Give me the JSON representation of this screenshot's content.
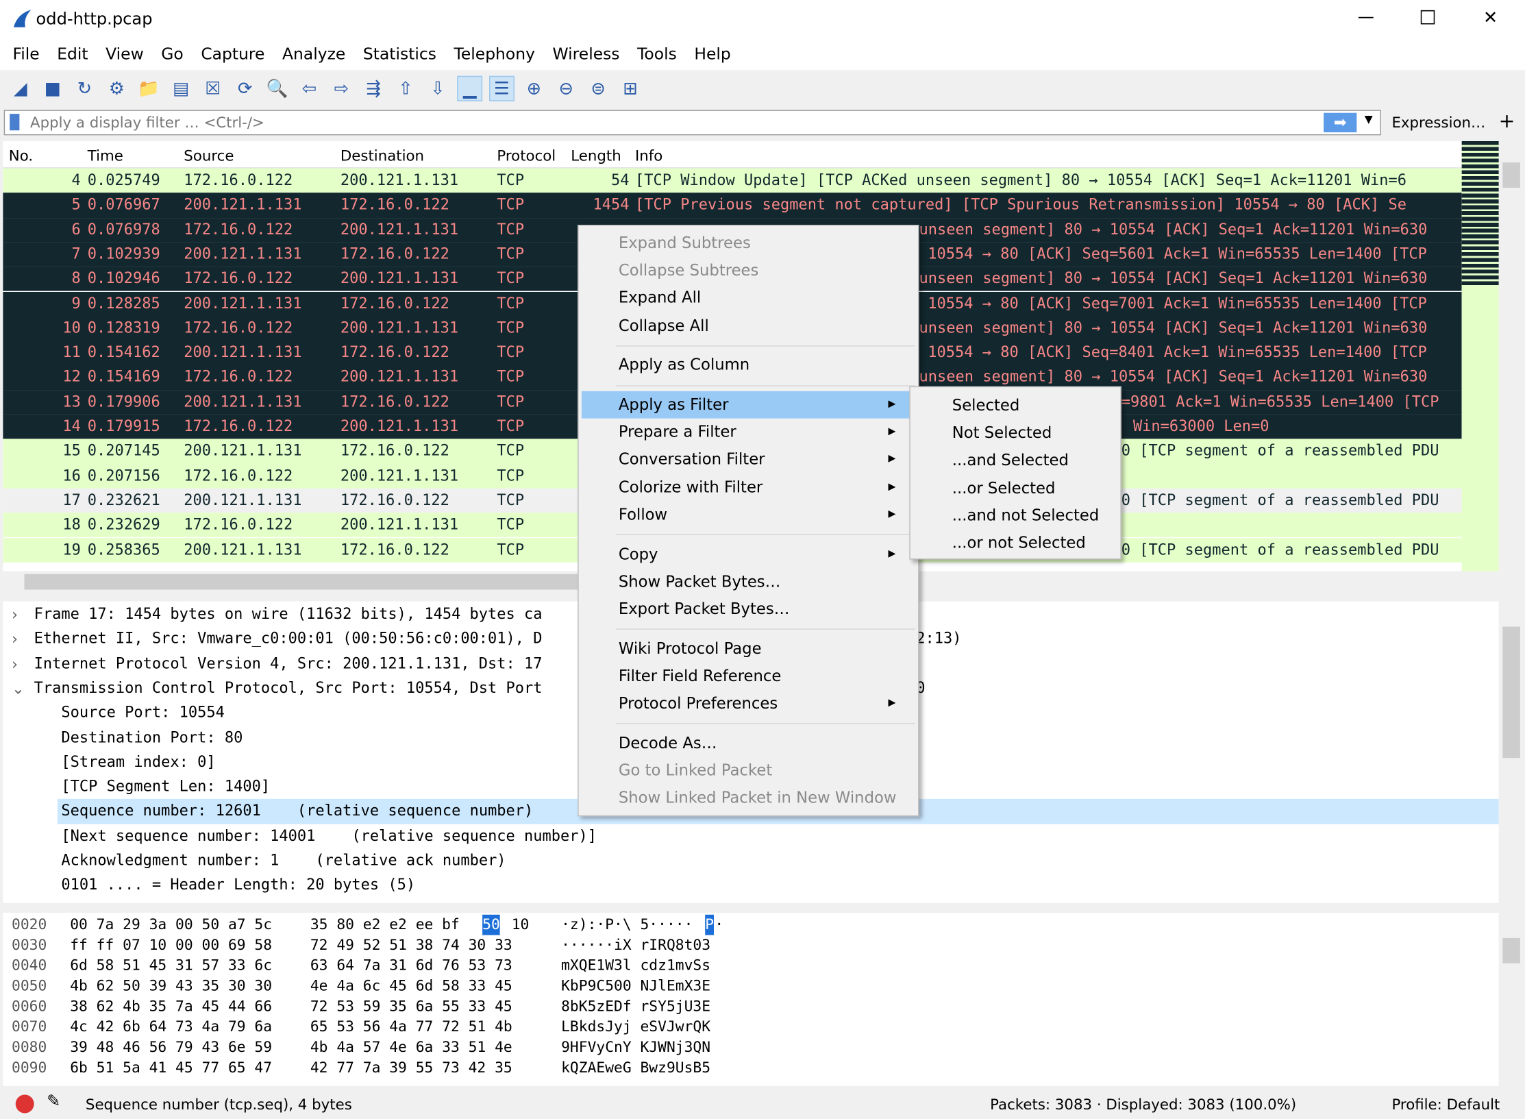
{
  "window": {
    "title": "odd-http.pcap",
    "minimize": "—",
    "maximize": "☐",
    "close": "✕"
  },
  "menu": [
    "File",
    "Edit",
    "View",
    "Go",
    "Capture",
    "Analyze",
    "Statistics",
    "Telephony",
    "Wireless",
    "Tools",
    "Help"
  ],
  "toolbar_icons": [
    "shark-fin-start-icon",
    "stop-icon",
    "restart-icon",
    "options-gear-icon",
    "open-folder-icon",
    "save-file-icon",
    "close-file-icon",
    "reload-icon",
    "find-icon",
    "back-arrow-icon",
    "forward-arrow-icon",
    "go-to-packet-icon",
    "first-packet-icon",
    "last-packet-icon",
    "autoscroll-icon",
    "colorize-icon",
    "zoom-in-icon",
    "zoom-out-icon",
    "normal-size-icon",
    "resize-columns-icon"
  ],
  "filter": {
    "placeholder": "Apply a display filter … <Ctrl-/>",
    "expression": "Expression…",
    "plus": "+"
  },
  "columns": [
    "No.",
    "Time",
    "Source",
    "Destination",
    "Protocol",
    "Length",
    "Info"
  ],
  "packets": [
    {
      "no": "4",
      "time": "0.025749",
      "src": "172.16.0.122",
      "dst": "200.121.1.131",
      "proto": "TCP",
      "len": "54",
      "info": "[TCP Window Update] [TCP ACKed unseen segment] 80 → 10554 [ACK] Seq=1 Ack=11201 Win=6",
      "style": "g"
    },
    {
      "no": "5",
      "time": "0.076967",
      "src": "200.121.1.131",
      "dst": "172.16.0.122",
      "proto": "TCP",
      "len": "1454",
      "info": "[TCP Previous segment not captured] [TCP Spurious Retransmission] 10554 → 80 [ACK] Se",
      "style": "d"
    },
    {
      "no": "6",
      "time": "0.076978",
      "src": "172.16.0.122",
      "dst": "200.121.1.131",
      "proto": "TCP",
      "len": "",
      "info": "unseen segment] 80 → 10554 [ACK] Seq=1 Ack=11201 Win=630",
      "style": "d"
    },
    {
      "no": "7",
      "time": "0.102939",
      "src": "200.121.1.131",
      "dst": "172.16.0.122",
      "proto": "TCP",
      "len": "",
      "info": "10554 → 80 [ACK] Seq=5601 Ack=1 Win=65535 Len=1400 [TCP",
      "style": "d"
    },
    {
      "no": "8",
      "time": "0.102946",
      "src": "172.16.0.122",
      "dst": "200.121.1.131",
      "proto": "TCP",
      "len": "",
      "info": "unseen segment] 80 → 10554 [ACK] Seq=1 Ack=11201 Win=630",
      "style": "d"
    },
    {
      "no": "9",
      "time": "0.128285",
      "src": "200.121.1.131",
      "dst": "172.16.0.122",
      "proto": "TCP",
      "len": "",
      "info": "10554 → 80 [ACK] Seq=7001 Ack=1 Win=65535 Len=1400 [TCP",
      "style": "d"
    },
    {
      "no": "10",
      "time": "0.128319",
      "src": "172.16.0.122",
      "dst": "200.121.1.131",
      "proto": "TCP",
      "len": "",
      "info": "unseen segment] 80 → 10554 [ACK] Seq=1 Ack=11201 Win=630",
      "style": "d"
    },
    {
      "no": "11",
      "time": "0.154162",
      "src": "200.121.1.131",
      "dst": "172.16.0.122",
      "proto": "TCP",
      "len": "",
      "info": "10554 → 80 [ACK] Seq=8401 Ack=1 Win=65535 Len=1400 [TCP",
      "style": "d"
    },
    {
      "no": "12",
      "time": "0.154169",
      "src": "172.16.0.122",
      "dst": "200.121.1.131",
      "proto": "TCP",
      "len": "",
      "info": "unseen segment] 80 → 10554 [ACK] Seq=1 Ack=11201 Win=630",
      "style": "d"
    },
    {
      "no": "13",
      "time": "0.179906",
      "src": "200.121.1.131",
      "dst": "172.16.0.122",
      "proto": "TCP",
      "len": "",
      "info": "=9801 Ack=1 Win=65535 Len=1400 [TCP",
      "style": "d"
    },
    {
      "no": "14",
      "time": "0.179915",
      "src": "172.16.0.122",
      "dst": "200.121.1.131",
      "proto": "TCP",
      "len": "",
      "info": "Win=63000 Len=0",
      "style": "d"
    },
    {
      "no": "15",
      "time": "0.207145",
      "src": "200.121.1.131",
      "dst": "172.16.0.122",
      "proto": "TCP",
      "len": "",
      "info": "0 [TCP segment of a reassembled PDU",
      "style": "g"
    },
    {
      "no": "16",
      "time": "0.207156",
      "src": "172.16.0.122",
      "dst": "200.121.1.131",
      "proto": "TCP",
      "len": "",
      "info": "",
      "style": "g"
    },
    {
      "no": "17",
      "time": "0.232621",
      "src": "200.121.1.131",
      "dst": "172.16.0.122",
      "proto": "TCP",
      "len": "",
      "info": "0 [TCP segment of a reassembled PDU",
      "style": "w"
    },
    {
      "no": "18",
      "time": "0.232629",
      "src": "172.16.0.122",
      "dst": "200.121.1.131",
      "proto": "TCP",
      "len": "",
      "info": "",
      "style": "g"
    },
    {
      "no": "19",
      "time": "0.258365",
      "src": "200.121.1.131",
      "dst": "172.16.0.122",
      "proto": "TCP",
      "len": "",
      "info": "0 [TCP segment of a reassembled PDU",
      "style": "g"
    }
  ],
  "context_menu": [
    {
      "label": "Expand Subtrees",
      "disabled": true
    },
    {
      "label": "Collapse Subtrees",
      "disabled": true
    },
    {
      "label": "Expand All"
    },
    {
      "label": "Collapse All"
    },
    {
      "label": "Apply as Column"
    },
    {
      "label": "Apply as Filter",
      "submenu": true,
      "highlighted": true
    },
    {
      "label": "Prepare a Filter",
      "submenu": true
    },
    {
      "label": "Conversation Filter",
      "submenu": true
    },
    {
      "label": "Colorize with Filter",
      "submenu": true
    },
    {
      "label": "Follow",
      "submenu": true
    },
    {
      "label": "Copy",
      "submenu": true
    },
    {
      "label": "Show Packet Bytes…"
    },
    {
      "label": "Export Packet Bytes…"
    },
    {
      "label": "Wiki Protocol Page"
    },
    {
      "label": "Filter Field Reference"
    },
    {
      "label": "Protocol Preferences",
      "submenu": true
    },
    {
      "label": "Decode As…"
    },
    {
      "label": "Go to Linked Packet",
      "disabled": true
    },
    {
      "label": "Show Linked Packet in New Window",
      "disabled": true
    }
  ],
  "submenu": [
    "Selected",
    "Not Selected",
    "...and Selected",
    "...or Selected",
    "...and not Selected",
    "...or not Selected"
  ],
  "details": [
    {
      "text": "Frame 17: 1454 bytes on wire (11632 bits), 1454 bytes ca",
      "tail": "",
      "expander": "›",
      "indent": 0
    },
    {
      "text": "Ethernet II, Src: Vmware_c0:00:01 (00:50:56:c0:00:01), D",
      "tail": "2:13)",
      "expander": "›",
      "indent": 0
    },
    {
      "text": "Internet Protocol Version 4, Src: 200.121.1.131, Dst: 17",
      "tail": "",
      "expander": "›",
      "indent": 0
    },
    {
      "text": "Transmission Control Protocol, Src Port: 10554, Dst Port",
      "tail": "0",
      "expander": "⌄",
      "indent": 0
    },
    {
      "text": "Source Port: 10554",
      "indent": 1
    },
    {
      "text": "Destination Port: 80",
      "indent": 1
    },
    {
      "text": "[Stream index: 0]",
      "indent": 1
    },
    {
      "text": "[TCP Segment Len: 1400]",
      "indent": 1
    },
    {
      "text": "Sequence number: 12601    (relative sequence number)",
      "indent": 1,
      "selected": true
    },
    {
      "text": "[Next sequence number: 14001    (relative sequence number)]",
      "indent": 1
    },
    {
      "text": "Acknowledgment number: 1    (relative ack number)",
      "indent": 1
    },
    {
      "text": "0101 .... = Header Length: 20 bytes (5)",
      "indent": 1
    }
  ],
  "bytes": [
    {
      "off": "0020",
      "hex1": "00 7a 29 3a 00 50 a7 5c",
      "hex2": "35 80 e2 e2 ee bf",
      "hl": "50",
      "hex3": "10",
      "asc1": "·z):·P·\\ 5·····",
      "aschl": "P",
      "asc2": "·"
    },
    {
      "off": "0030",
      "hex1": "ff ff 07 10 00 00 69 58",
      "hex2": "72 49 52 51 38 74 30 33",
      "asc1": "······iX rIRQ8t03"
    },
    {
      "off": "0040",
      "hex1": "6d 58 51 45 31 57 33 6c",
      "hex2": "63 64 7a 31 6d 76 53 73",
      "asc1": "mXQE1W3l cdz1mvSs"
    },
    {
      "off": "0050",
      "hex1": "4b 62 50 39 43 35 30 30",
      "hex2": "4e 4a 6c 45 6d 58 33 45",
      "asc1": "KbP9C500 NJlEmX3E"
    },
    {
      "off": "0060",
      "hex1": "38 62 4b 35 7a 45 44 66",
      "hex2": "72 53 59 35 6a 55 33 45",
      "asc1": "8bK5zEDf rSY5jU3E"
    },
    {
      "off": "0070",
      "hex1": "4c 42 6b 64 73 4a 79 6a",
      "hex2": "65 53 56 4a 77 72 51 4b",
      "asc1": "LBkdsJyj eSVJwrQK"
    },
    {
      "off": "0080",
      "hex1": "39 48 46 56 79 43 6e 59",
      "hex2": "4b 4a 57 4e 6a 33 51 4e",
      "asc1": "9HFVyCnY KJWNj3QN"
    },
    {
      "off": "0090",
      "hex1": "6b 51 5a 41 45 77 65 47",
      "hex2": "42 77 7a 39 55 73 42 35",
      "asc1": "kQZAEweG Bwz9UsB5"
    }
  ],
  "status": {
    "field": "Sequence number (tcp.seq), 4 bytes",
    "packets": "Packets: 3083 · Displayed: 3083 (100.0%)",
    "profile": "Profile: Default"
  },
  "colors": {
    "green_row": "#e4ffc7",
    "dark_row": "#12272e",
    "dark_text": "#f78787",
    "selection": "#cce8ff",
    "menu_highlight": "#99c9f5"
  }
}
